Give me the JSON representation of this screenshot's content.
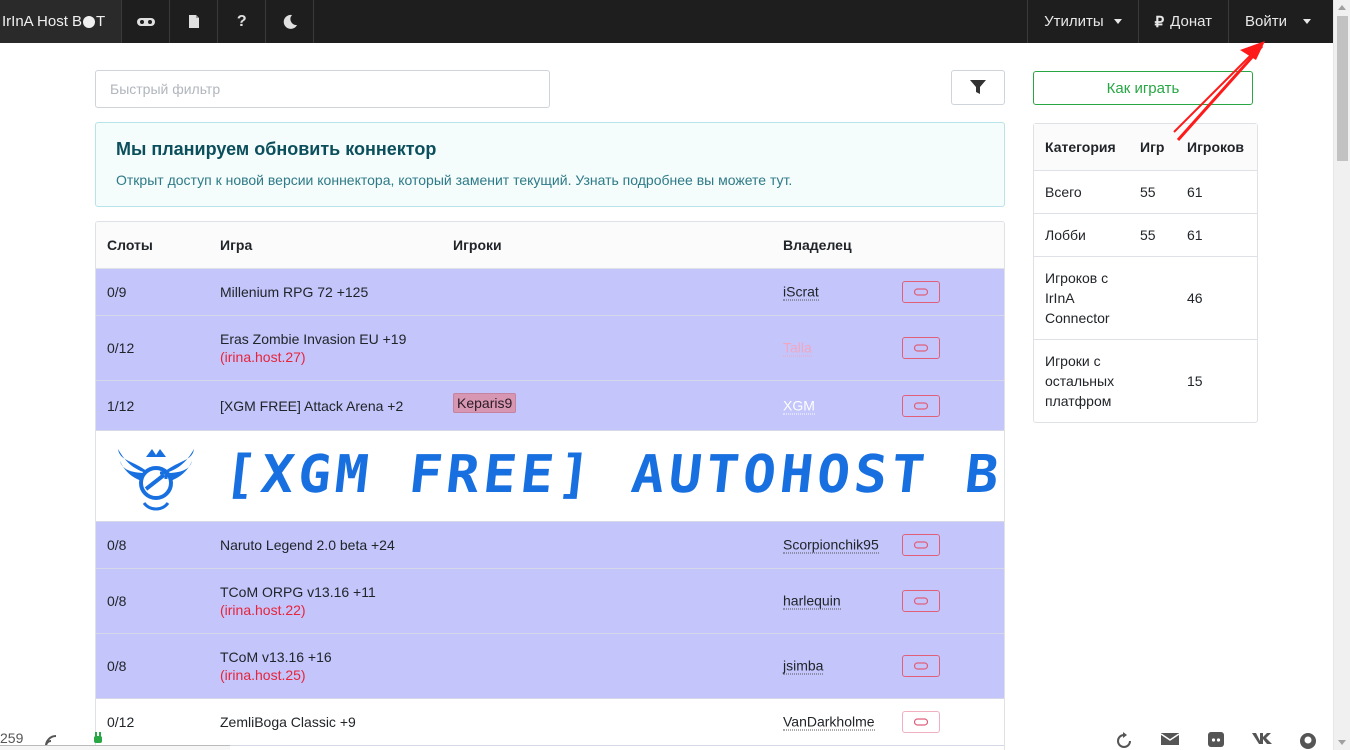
{
  "navbar": {
    "brand_prefix": "IrInA Host B",
    "brand_suffix": "T",
    "icons": [
      "gamepad-icon",
      "file-icon",
      "help-icon",
      "moon-icon"
    ],
    "help_glyph": "?",
    "utilities_label": "Утилиты",
    "donate_label": "Донат",
    "donate_glyph": "₽",
    "login_label": "Войти"
  },
  "filter": {
    "placeholder": "Быстрый фильтр"
  },
  "alert": {
    "title": "Мы планируем обновить коннектор",
    "text": "Открыт доступ к новой версии коннектора, который заменит текущий. Узнать подробнее вы можете тут."
  },
  "games_table": {
    "headers": {
      "slots": "Слоты",
      "game": "Игра",
      "players": "Игроки",
      "owner": "Владелец"
    },
    "rows": [
      {
        "slots": "0/9",
        "game": "Millenium RPG 72 +125",
        "host": "",
        "player": "",
        "owner": "iScrat"
      },
      {
        "slots": "0/12",
        "game": "Eras Zombie Invasion EU +19",
        "host": "(irina.host.27)",
        "player": "",
        "owner": "Talla"
      },
      {
        "slots": "1/12",
        "game": "[XGM FREE] Attack Arena +2",
        "host": "",
        "player": "Keparis9",
        "owner": "XGM"
      },
      {
        "slots": "0/8",
        "game": "Naruto Legend 2.0 beta +24",
        "host": "",
        "player": "",
        "owner": "Scorpionchik95"
      },
      {
        "slots": "0/8",
        "game": "TCoM ORPG v13.16 +11",
        "host": "(irina.host.22)",
        "player": "",
        "owner": "harlequin"
      },
      {
        "slots": "0/8",
        "game": "TCoM v13.16 +16",
        "host": "(irina.host.25)",
        "player": "",
        "owner": "jsimba"
      },
      {
        "slots": "0/12",
        "game": "ZemliBoga Classic +9",
        "host": "",
        "player": "",
        "owner": "VanDarkholme"
      }
    ],
    "banner_text": "[XGM FREE] AUTOHOST BOT"
  },
  "sidebar": {
    "howto_label": "Как играть",
    "stats_headers": {
      "category": "Категория",
      "games": "Игр",
      "players": "Игроков"
    },
    "stats_rows": [
      {
        "category": "Всего",
        "games": "55",
        "players": "61"
      },
      {
        "category": "Лобби",
        "games": "55",
        "players": "61"
      },
      {
        "category_lines": [
          "Игроков с",
          "IrInA",
          "Connector"
        ],
        "games": "",
        "players": "46"
      },
      {
        "category_lines": [
          "Игроки с",
          "остальных",
          "платфром"
        ],
        "games": "",
        "players": "15"
      }
    ]
  },
  "footer": {
    "left_text": "259",
    "icons": [
      "refresh-icon",
      "mail-icon",
      "discord-icon",
      "vk-icon",
      "github-icon"
    ]
  },
  "colors": {
    "navbar_bg": "#1e1e1e",
    "row_highlight": "#c3c5fb",
    "accent_green": "#28a745",
    "host_red": "#e8243a",
    "banner_blue": "#1870e0",
    "annotation_red": "#ff1a1a"
  }
}
